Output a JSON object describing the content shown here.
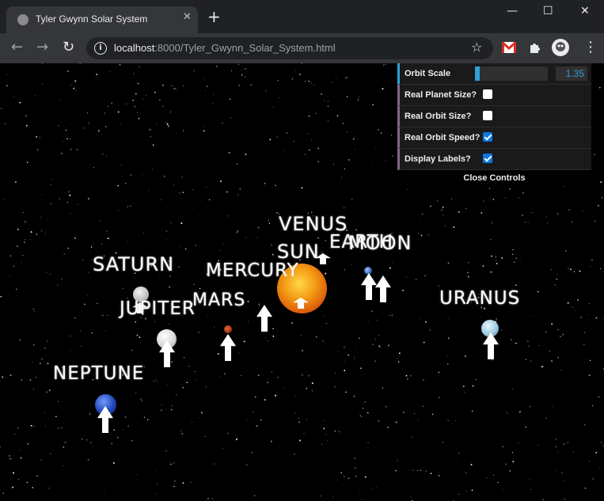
{
  "browser": {
    "tab_title": "Tyler Gwynn Solar System",
    "tab_close": "✕",
    "new_tab": "+",
    "url_host": "localhost",
    "url_rest": ":8000/Tyler_Gwynn_Solar_System.html",
    "window_controls": {
      "minimize": "—",
      "maximize": "☐",
      "close": "✕"
    }
  },
  "scene": {
    "labels": {
      "venus": "VENUS",
      "earth": "EARTH",
      "moon": "MOON",
      "sun": "SUN",
      "mercury": "MERCURY",
      "saturn": "SATURN",
      "mars": "MARS",
      "jupiter": "JUPITER",
      "uranus": "URANUS",
      "neptune": "NEPTUNE"
    }
  },
  "controls": {
    "orbit_scale_label": "Orbit Scale",
    "orbit_scale_value": "1.35",
    "orbit_scale_fraction": 0.07,
    "real_planet_size_label": "Real Planet Size?",
    "real_planet_size": false,
    "real_orbit_size_label": "Real Orbit Size?",
    "real_orbit_size": false,
    "real_orbit_speed_label": "Real Orbit Speed?",
    "real_orbit_speed": true,
    "display_labels_label": "Display Labels?",
    "display_labels": true,
    "close_label": "Close Controls"
  },
  "colors": {
    "accent_number": "#2fa1d6",
    "accent_bool": "#806787",
    "checkbox_checked": "#0b76e6"
  }
}
